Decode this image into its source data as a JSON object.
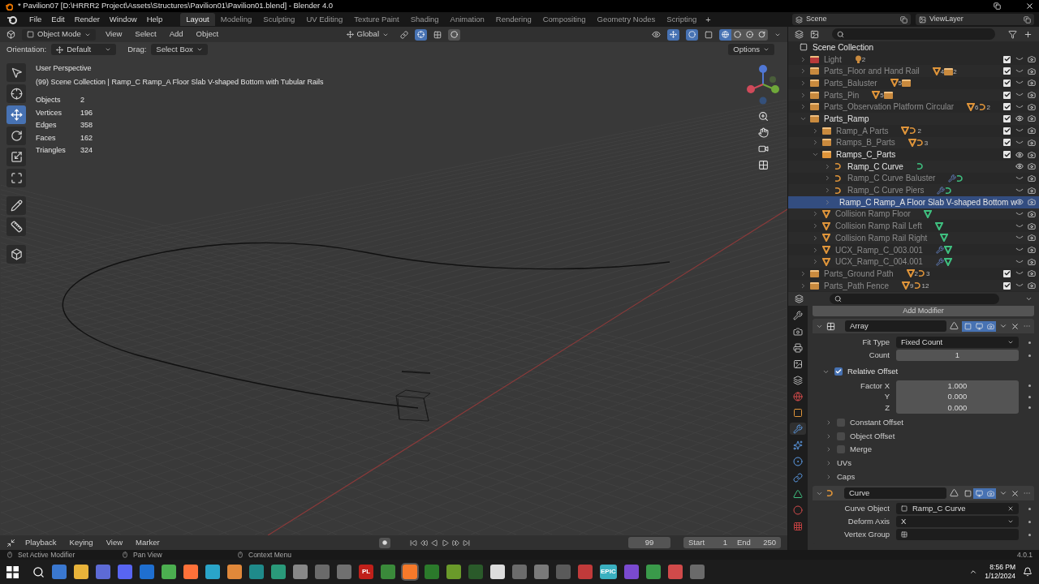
{
  "title_bar": {
    "title": "* Pavilion07 [D:\\HRRR2 Project\\Assets\\Structures\\Pavilion01\\Pavilion01.blend] - Blender 4.0"
  },
  "menu": [
    "File",
    "Edit",
    "Render",
    "Window",
    "Help"
  ],
  "workspaces": [
    {
      "label": "Layout",
      "selected": true
    },
    {
      "label": "Modeling",
      "selected": false
    },
    {
      "label": "Sculpting",
      "selected": false
    },
    {
      "label": "UV Editing",
      "selected": false
    },
    {
      "label": "Texture Paint",
      "selected": false
    },
    {
      "label": "Shading",
      "selected": false
    },
    {
      "label": "Animation",
      "selected": false
    },
    {
      "label": "Rendering",
      "selected": false
    },
    {
      "label": "Compositing",
      "selected": false
    },
    {
      "label": "Geometry Nodes",
      "selected": false
    },
    {
      "label": "Scripting",
      "selected": false
    }
  ],
  "add_workspace": "+",
  "scene": {
    "name": "Scene"
  },
  "view_layer": {
    "name": "ViewLayer"
  },
  "viewport": {
    "mode": "Object Mode",
    "menus": [
      "View",
      "Select",
      "Add",
      "Object"
    ],
    "transform_orientation": "Global",
    "orientation_label": "Orientation:",
    "orientation": "Default",
    "drag_label": "Drag:",
    "drag": "Select Box",
    "options": "Options",
    "tools": [
      {
        "kind": "select",
        "selected": false
      },
      {
        "kind": "cursor",
        "selected": false
      },
      {
        "kind": "move",
        "selected": true
      },
      {
        "kind": "rotate",
        "selected": false
      },
      {
        "kind": "scale",
        "selected": false
      },
      {
        "kind": "transform",
        "selected": false
      },
      {
        "kind": "annotate",
        "selected": false
      },
      {
        "kind": "measure",
        "selected": false
      },
      {
        "kind": "add-cube",
        "selected": false
      }
    ]
  },
  "overlay": {
    "view_name": "User Perspective",
    "context": "(99) Scene Collection | Ramp_C Ramp_A Floor Slab V-shaped Bottom with Tubular Rails",
    "stats": [
      {
        "label": "Objects",
        "value": "2"
      },
      {
        "label": "Vertices",
        "value": "196"
      },
      {
        "label": "Edges",
        "value": "358"
      },
      {
        "label": "Faces",
        "value": "162"
      },
      {
        "label": "Triangles",
        "value": "324"
      }
    ]
  },
  "outliner": {
    "root": "Scene Collection",
    "items": [
      {
        "name": "Light",
        "kind": "collection",
        "color": "#b83a3a",
        "expanded": false,
        "checked": true,
        "visible": false,
        "selected": false,
        "extras": [
          {
            "kind": "light",
            "count": "2"
          }
        ]
      },
      {
        "name": "Parts_Floor and Hand Rail",
        "kind": "collection",
        "color": "#c98a3e",
        "expanded": false,
        "checked": true,
        "visible": false,
        "selected": false,
        "extras": [
          {
            "kind": "mesh",
            "count": "4"
          },
          {
            "kind": "collection",
            "count": "2"
          }
        ]
      },
      {
        "name": "Parts_Baluster",
        "kind": "collection",
        "color": "#c98a3e",
        "expanded": false,
        "checked": true,
        "visible": false,
        "selected": false,
        "extras": [
          {
            "kind": "mesh",
            "count": "5"
          },
          {
            "kind": "collection"
          }
        ]
      },
      {
        "name": "Parts_Pin",
        "kind": "collection",
        "color": "#c98a3e",
        "expanded": false,
        "checked": true,
        "visible": false,
        "selected": false,
        "extras": [
          {
            "kind": "mesh",
            "count": "5"
          },
          {
            "kind": "collection"
          }
        ]
      },
      {
        "name": "Parts_Observation Platform Circular",
        "kind": "collection",
        "color": "#c98a3e",
        "expanded": false,
        "checked": true,
        "visible": false,
        "selected": false,
        "extras": [
          {
            "kind": "mesh",
            "count": "6"
          },
          {
            "kind": "curve",
            "count": "2"
          }
        ]
      },
      {
        "name": "Parts_Ramp",
        "kind": "collection",
        "color": "#c98a3e",
        "expanded": true,
        "checked": true,
        "visible": true,
        "selected": false,
        "children": [
          {
            "name": "Ramp_A Parts",
            "kind": "collection",
            "color": "#c98a3e",
            "expanded": false,
            "checked": true,
            "visible": false,
            "selected": false,
            "extras": [
              {
                "kind": "mesh"
              },
              {
                "kind": "curve",
                "count": "2"
              }
            ]
          },
          {
            "name": "Ramps_B_Parts",
            "kind": "collection",
            "color": "#c98a3e",
            "expanded": false,
            "checked": true,
            "visible": false,
            "selected": false,
            "extras": [
              {
                "kind": "mesh"
              },
              {
                "kind": "curve",
                "count": "3"
              }
            ]
          },
          {
            "name": "Ramps_C_Parts",
            "kind": "collection",
            "color": "#e0953a",
            "expanded": true,
            "checked": true,
            "visible": true,
            "selected": false,
            "children": [
              {
                "name": "Ramp_C Curve",
                "kind": "curve",
                "expanded": false,
                "visible": true,
                "selected": false,
                "extras": [
                  {
                    "kind": "curve-data"
                  }
                ]
              },
              {
                "name": "Ramp_C Curve Baluster",
                "kind": "curve",
                "expanded": false,
                "visible": false,
                "selected": false,
                "extras": [
                  {
                    "kind": "modifier"
                  },
                  {
                    "kind": "curve-data"
                  }
                ]
              },
              {
                "name": "Ramp_C Curve Piers",
                "kind": "curve",
                "expanded": false,
                "visible": false,
                "selected": false,
                "extras": [
                  {
                    "kind": "modifier"
                  },
                  {
                    "kind": "curve-data"
                  }
                ]
              },
              {
                "name": "Ramp_C Ramp_A Floor Slab V-shaped Bottom w",
                "kind": "mesh",
                "expanded": false,
                "visible": true,
                "selected": true
              }
            ]
          },
          {
            "name": "Collision Ramp Floor",
            "kind": "mesh",
            "expanded": false,
            "visible": false,
            "selected": false,
            "extras": [
              {
                "kind": "mesh-data"
              }
            ]
          },
          {
            "name": "Collision Ramp Rail Left",
            "kind": "mesh",
            "expanded": false,
            "visible": false,
            "selected": false,
            "extras": [
              {
                "kind": "mesh-data"
              }
            ]
          },
          {
            "name": "Collision Ramp Rail Right",
            "kind": "mesh",
            "expanded": false,
            "visible": false,
            "selected": false,
            "extras": [
              {
                "kind": "mesh-data"
              }
            ]
          },
          {
            "name": "UCX_Ramp_C_003.001",
            "kind": "mesh",
            "expanded": false,
            "visible": false,
            "selected": false,
            "extras": [
              {
                "kind": "modifier"
              },
              {
                "kind": "mesh-data"
              }
            ]
          },
          {
            "name": "UCX_Ramp_C_004.001",
            "kind": "mesh",
            "expanded": false,
            "visible": false,
            "selected": false,
            "extras": [
              {
                "kind": "modifier"
              },
              {
                "kind": "mesh-data"
              }
            ]
          }
        ]
      },
      {
        "name": "Parts_Ground Path",
        "kind": "collection",
        "color": "#c98a3e",
        "expanded": false,
        "checked": true,
        "visible": false,
        "selected": false,
        "extras": [
          {
            "kind": "mesh",
            "count": "2"
          },
          {
            "kind": "curve",
            "count": "3"
          }
        ]
      },
      {
        "name": "Parts_Path Fence",
        "kind": "collection",
        "color": "#c98a3e",
        "expanded": false,
        "checked": true,
        "visible": false,
        "selected": false,
        "extras": [
          {
            "kind": "mesh",
            "count": "9"
          },
          {
            "kind": "curve",
            "count": "12"
          }
        ]
      }
    ]
  },
  "properties": {
    "tabs": [
      {
        "kind": "tool",
        "selected": false
      },
      {
        "kind": "render",
        "selected": false
      },
      {
        "kind": "output",
        "selected": false
      },
      {
        "kind": "view-layer",
        "selected": false
      },
      {
        "kind": "scene",
        "selected": false
      },
      {
        "kind": "world",
        "selected": false
      },
      {
        "kind": "object",
        "selected": false
      },
      {
        "kind": "modifier",
        "selected": true
      },
      {
        "kind": "particles",
        "selected": false
      },
      {
        "kind": "physics",
        "selected": false
      },
      {
        "kind": "constraints",
        "selected": false
      },
      {
        "kind": "data",
        "selected": false
      },
      {
        "kind": "material",
        "selected": false
      },
      {
        "kind": "texture",
        "selected": false
      }
    ],
    "add_modifier": "Add Modifier",
    "modifiers": [
      {
        "kind": "array",
        "name": "Array",
        "edit_mode": true,
        "show_viewport": true,
        "show_render": true,
        "fit_type_label": "Fit Type",
        "fit_type": "Fixed Count",
        "count_label": "Count",
        "count": "1",
        "relative_offset": {
          "label": "Relative Offset",
          "checked": true,
          "factors": [
            {
              "label": "Factor X",
              "value": "1.000"
            },
            {
              "label": "Y",
              "value": "0.000"
            },
            {
              "label": "Z",
              "value": "0.000"
            }
          ]
        },
        "subpanels": [
          {
            "label": "Constant Offset",
            "kind": "checkbox",
            "checked": false
          },
          {
            "label": "Object Offset",
            "kind": "checkbox",
            "checked": false
          },
          {
            "label": "Merge",
            "kind": "checkbox",
            "checked": false
          },
          {
            "label": "UVs",
            "kind": "plain"
          },
          {
            "label": "Caps",
            "kind": "plain"
          }
        ]
      },
      {
        "kind": "curve",
        "name": "Curve",
        "edit_mode": false,
        "show_viewport": true,
        "show_render": true,
        "curve_object_label": "Curve Object",
        "curve_object": "Ramp_C Curve",
        "deform_axis_label": "Deform Axis",
        "deform_axis": "X",
        "vertex_group_label": "Vertex Group"
      }
    ]
  },
  "timeline": {
    "menus": [
      "Playback",
      "Keying",
      "View",
      "Marker"
    ],
    "current_frame": "99",
    "start_label": "Start",
    "start": "1",
    "end_label": "End",
    "end": "250"
  },
  "status_bar": {
    "hints": [
      "Set Active Modifier",
      "Pan View",
      "Context Menu"
    ],
    "version": "4.0.1"
  },
  "taskbar": {
    "labels": [
      "PL",
      "EPIC"
    ],
    "time": "8:56 PM",
    "date": "1/12/2024"
  }
}
